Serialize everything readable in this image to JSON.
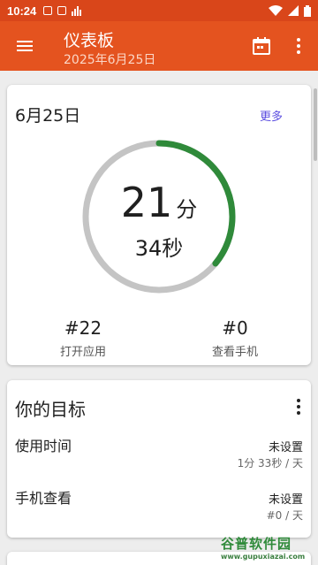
{
  "status_bar": {
    "time": "10:24"
  },
  "app_bar": {
    "title": "仪表板",
    "subtitle": "2025年6月25日"
  },
  "today_card": {
    "date": "6月25日",
    "more_label": "更多",
    "usage_minutes_value": "21",
    "usage_minutes_unit": "分",
    "usage_seconds": "34秒",
    "progress_fraction": 0.36,
    "ring_track_color": "#c4c4c4",
    "ring_progress_color": "#2f8a3a",
    "apps_opened_value": "#22",
    "apps_opened_label": "打开应用",
    "phone_checks_value": "#0",
    "phone_checks_label": "查看手机"
  },
  "goals_card": {
    "title": "你的目标",
    "items": [
      {
        "name": "使用时间",
        "state": "未设置",
        "limit": "1分 33秒 / 天"
      },
      {
        "name": "手机查看",
        "state": "未设置",
        "limit": "#0 / 天"
      }
    ]
  },
  "watermark": {
    "text": "谷普软件园",
    "url": "www.gupuxiazai.com"
  },
  "colors": {
    "app_bar": "#e4531f",
    "status_bar": "#d9461a",
    "accent_link": "#5b4de0"
  }
}
